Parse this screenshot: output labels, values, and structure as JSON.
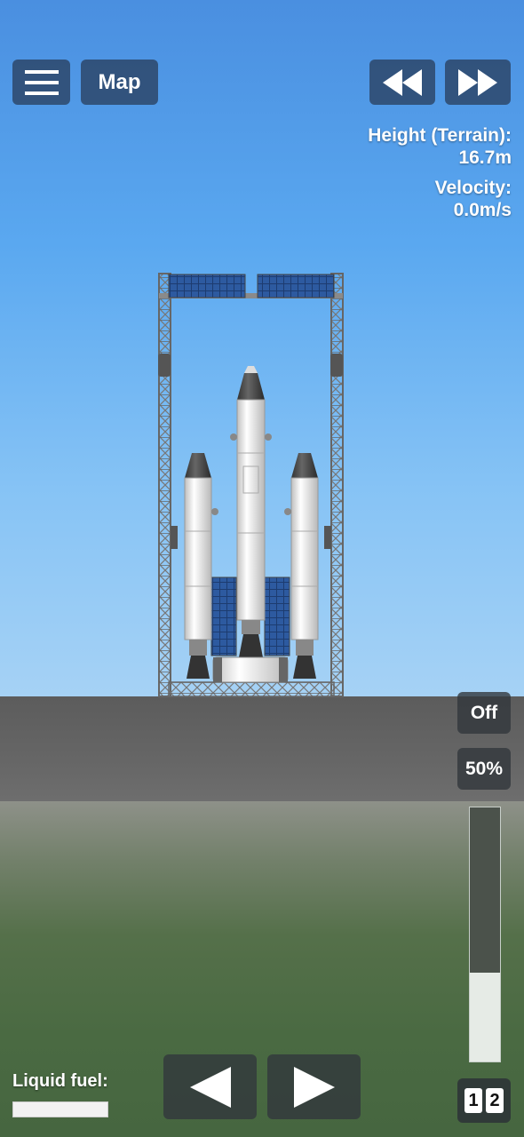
{
  "top_bar": {
    "menu_icon": "hamburger-menu-icon",
    "map_label": "Map",
    "rewind_icon": "rewind-icon",
    "fast_forward_icon": "fast-forward-icon"
  },
  "telemetry": {
    "height_label": "Height (Terrain):",
    "height_value": "16.7m",
    "velocity_label": "Velocity:",
    "velocity_value": "0.0m/s"
  },
  "right_controls": {
    "toggle_label": "Off",
    "throttle_percent_label": "50%",
    "throttle_fraction": 0.35
  },
  "bottom": {
    "fuel_label": "Liquid fuel:",
    "fuel_fraction": 1.0,
    "rotate_left_icon": "rotate-left-icon",
    "rotate_right_icon": "rotate-right-icon",
    "stage_digits": [
      "1",
      "2"
    ]
  },
  "colors": {
    "button_bg": "#2a3c5a",
    "sky_top": "#4a8fe0",
    "ground": "#666666",
    "grass": "#4a6a42"
  }
}
